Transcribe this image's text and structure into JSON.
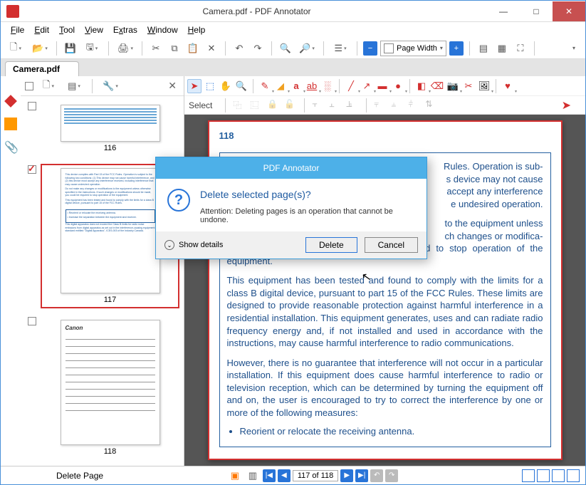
{
  "window": {
    "title": "Camera.pdf - PDF Annotator",
    "min": "—",
    "max": "□",
    "close": "✕"
  },
  "menu": {
    "file": "File",
    "edit": "Edit",
    "tool": "Tool",
    "view": "View",
    "extras": "Extras",
    "window": "Window",
    "help": "Help"
  },
  "toolbar": {
    "zoom_mode": "Page Width"
  },
  "tab": {
    "title": "Camera.pdf"
  },
  "thumbs": {
    "p116": "116",
    "p117": "117",
    "p118": "118"
  },
  "annot2": {
    "label": "Select"
  },
  "doc": {
    "page_num": "118",
    "para1_partial": "Rules. Operation is sub-",
    "para1_l2": "s device may not cause",
    "para1_l3": "accept any interference",
    "para1_l4": "e undesired operation.",
    "para2_partial": "to the equipment unless",
    "para2_l2": "ch changes or modifica-",
    "para2_full": "tions should be made, you could be required to stop operation of the equipment.",
    "para3": "This equipment has been tested and found to comply with the limits for a class B digital device, pursuant to part 15 of the FCC Rules. These limits are designed to provide reasonable protection against harmful interference in a residential installation. This equipment generates, uses and can radiate radio frequency energy and, if not installed and used in accordance with the instructions, may cause harmful interference to radio communications.",
    "para4": "However, there is no guarantee that interference will not occur in a particular installation. If this equipment does cause harmful interference to radio or television reception, which can be determined by turning the equipment off and on, the user is encouraged to try to correct the interference by one or more of the following measures:",
    "bullet1": "Reorient or relocate the receiving antenna."
  },
  "status": {
    "label": "Delete Page",
    "page_of": "117 of 118"
  },
  "dialog": {
    "title": "PDF Annotator",
    "heading": "Delete selected page(s)?",
    "body": "Attention: Deleting pages is an operation that cannot be undone.",
    "show_details": "Show details",
    "delete": "Delete",
    "cancel": "Cancel"
  }
}
